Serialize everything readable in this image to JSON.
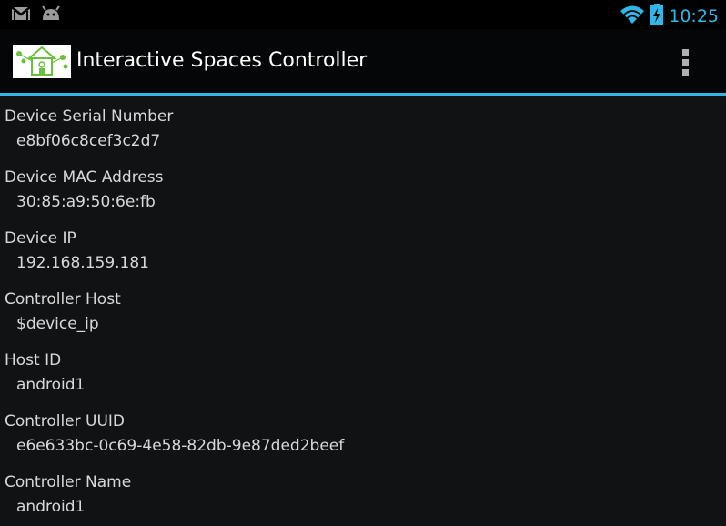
{
  "status_bar": {
    "time": "10:25",
    "icons": [
      "gmail-icon",
      "android-debug-icon",
      "wifi-icon",
      "battery-charging-icon"
    ],
    "accent": "#33b5e5"
  },
  "action_bar": {
    "title": "Interactive Spaces Controller",
    "icon": "app-logo-icon",
    "menu_icon": "overflow-menu-icon"
  },
  "settings": [
    {
      "label": "Device Serial Number",
      "value": "e8bf06c8cef3c2d7"
    },
    {
      "label": "Device MAC Address",
      "value": "30:85:a9:50:6e:fb"
    },
    {
      "label": "Device IP",
      "value": "192.168.159.181"
    },
    {
      "label": "Controller Host",
      "value": "$device_ip"
    },
    {
      "label": "Host ID",
      "value": "android1"
    },
    {
      "label": "Controller UUID",
      "value": "e6e633bc-0c69-4e58-82db-9e87ded2beef"
    },
    {
      "label": "Controller Name",
      "value": "android1"
    }
  ]
}
